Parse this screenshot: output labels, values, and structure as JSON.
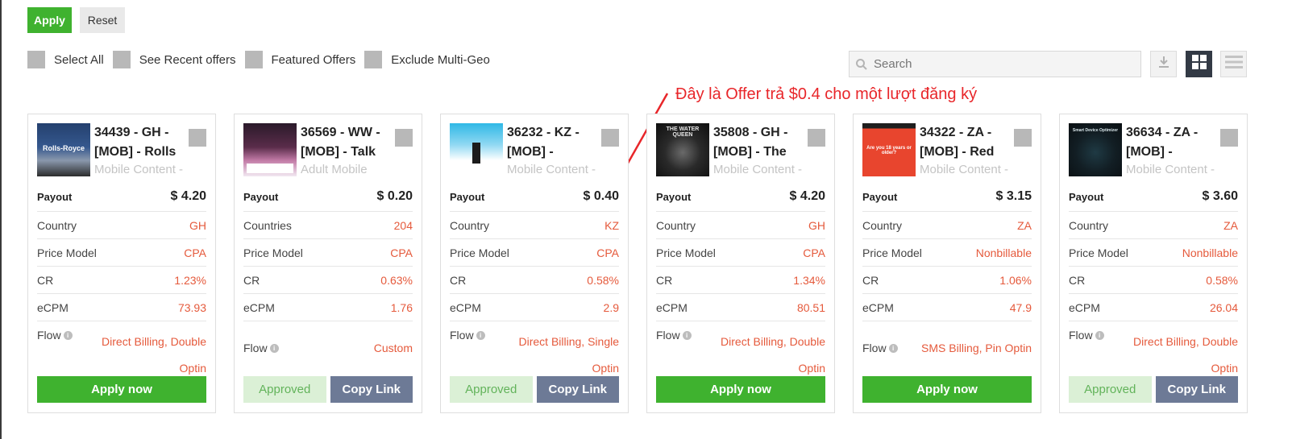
{
  "top_actions": {
    "apply_label": "Apply",
    "reset_label": "Reset"
  },
  "filters": [
    {
      "label": "Select All"
    },
    {
      "label": "See Recent offers"
    },
    {
      "label": "Featured Offers"
    },
    {
      "label": "Exclude Multi-Geo"
    }
  ],
  "search": {
    "placeholder": "Search"
  },
  "toolbar": {
    "download_icon": "download-icon",
    "grid_icon": "grid-view-icon",
    "list_icon": "list-view-icon"
  },
  "annotation": {
    "text": "Đây là Offer trả $0.4 cho một lượt đăng ký",
    "color": "#e8262a"
  },
  "colors": {
    "accent_green": "#3fb22f",
    "value_orange": "#e55a3c",
    "copy_button": "#6d7a96",
    "approved_bg": "#dbf0d6"
  },
  "cards": [
    {
      "thumb_caption": "Rolls-Royce",
      "title": "34439 - GH - [MOB] - Rolls",
      "category": "Mobile Content -",
      "payout_label": "Payout",
      "payout": "$ 4.20",
      "country_label": "Country",
      "country": "GH",
      "price_model_label": "Price Model",
      "price_model": "CPA",
      "cr_label": "CR",
      "cr": "1.23%",
      "ecpm_label": "eCPM",
      "ecpm": "73.93",
      "flow_label": "Flow",
      "flow": "Direct Billing, Double Optin",
      "actions": [
        "Apply now"
      ]
    },
    {
      "thumb_caption": "",
      "title": "36569 - WW - [MOB] - Talk",
      "category": "Adult Mobile",
      "payout_label": "Payout",
      "payout": "$ 0.20",
      "country_label": "Countries",
      "country": "204",
      "price_model_label": "Price Model",
      "price_model": "CPA",
      "cr_label": "CR",
      "cr": "0.63%",
      "ecpm_label": "eCPM",
      "ecpm": "1.76",
      "flow_label": "Flow",
      "flow": "Custom",
      "actions": [
        "Approved",
        "Copy Link"
      ]
    },
    {
      "thumb_caption": "",
      "title": "36232 - KZ - [MOB] -",
      "category": "Mobile Content -",
      "payout_label": "Payout",
      "payout": "$ 0.40",
      "country_label": "Country",
      "country": "KZ",
      "price_model_label": "Price Model",
      "price_model": "CPA",
      "cr_label": "CR",
      "cr": "0.58%",
      "ecpm_label": "eCPM",
      "ecpm": "2.9",
      "flow_label": "Flow",
      "flow": "Direct Billing, Single Optin",
      "actions": [
        "Approved",
        "Copy Link"
      ]
    },
    {
      "thumb_caption": "THE WATER QUEEN",
      "title": "35808 - GH - [MOB] - The",
      "category": "Mobile Content -",
      "payout_label": "Payout",
      "payout": "$ 4.20",
      "country_label": "Country",
      "country": "GH",
      "price_model_label": "Price Model",
      "price_model": "CPA",
      "cr_label": "CR",
      "cr": "1.34%",
      "ecpm_label": "eCPM",
      "ecpm": "80.51",
      "flow_label": "Flow",
      "flow": "Direct Billing, Double Optin",
      "actions": [
        "Apply now"
      ]
    },
    {
      "thumb_caption": "Are you 18 years or older?",
      "title": "34322 - ZA - [MOB] - Red",
      "category": "Mobile Content -",
      "payout_label": "Payout",
      "payout": "$ 3.15",
      "country_label": "Country",
      "country": "ZA",
      "price_model_label": "Price Model",
      "price_model": "Nonbillable",
      "cr_label": "CR",
      "cr": "1.06%",
      "ecpm_label": "eCPM",
      "ecpm": "47.9",
      "flow_label": "Flow",
      "flow": "SMS Billing, Pin Optin",
      "actions": [
        "Apply now"
      ]
    },
    {
      "thumb_caption": "Smart Device Optimizer",
      "title": "36634 - ZA - [MOB] -",
      "category": "Mobile Content -",
      "payout_label": "Payout",
      "payout": "$ 3.60",
      "country_label": "Country",
      "country": "ZA",
      "price_model_label": "Price Model",
      "price_model": "Nonbillable",
      "cr_label": "CR",
      "cr": "0.58%",
      "ecpm_label": "eCPM",
      "ecpm": "26.04",
      "flow_label": "Flow",
      "flow": "Direct Billing, Double Optin",
      "actions": [
        "Approved",
        "Copy Link"
      ]
    }
  ]
}
